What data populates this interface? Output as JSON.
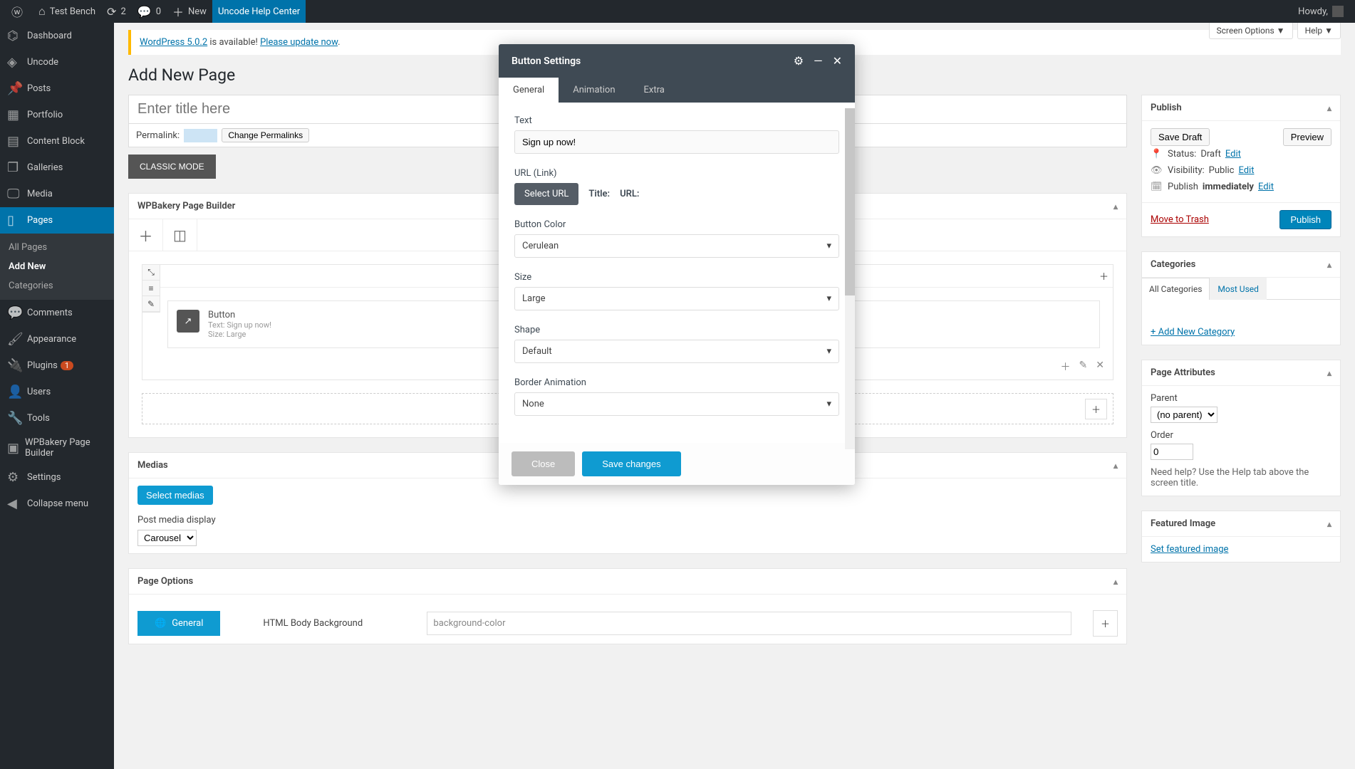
{
  "adminbar": {
    "site": "Test Bench",
    "updates": "2",
    "comments": "0",
    "new": "New",
    "help_center": "Uncode Help Center",
    "howdy": "Howdy,"
  },
  "sidebar": {
    "items": [
      {
        "label": "Dashboard",
        "icon": "⌬"
      },
      {
        "label": "Uncode",
        "icon": "◈"
      },
      {
        "label": "Posts",
        "icon": "📌"
      },
      {
        "label": "Portfolio",
        "icon": "▦"
      },
      {
        "label": "Content Block",
        "icon": "▤"
      },
      {
        "label": "Galleries",
        "icon": "❐"
      },
      {
        "label": "Media",
        "icon": "🖵"
      },
      {
        "label": "Pages",
        "icon": "▯",
        "current": true
      },
      {
        "label": "Comments",
        "icon": "💬"
      },
      {
        "label": "Appearance",
        "icon": "🖌"
      },
      {
        "label": "Plugins",
        "icon": "🔌",
        "badge": "1"
      },
      {
        "label": "Users",
        "icon": "👤"
      },
      {
        "label": "Tools",
        "icon": "🔧"
      },
      {
        "label": "WPBakery Page Builder",
        "icon": "▣"
      },
      {
        "label": "Settings",
        "icon": "⚙"
      },
      {
        "label": "Collapse menu",
        "icon": "◀"
      }
    ],
    "submenu": [
      {
        "label": "All Pages"
      },
      {
        "label": "Add New",
        "current": true
      },
      {
        "label": "Categories"
      }
    ]
  },
  "screen_tabs": {
    "options": "Screen Options ▼",
    "help": "Help ▼"
  },
  "notice": {
    "pre": "WordPress 5.0.2",
    "mid": " is available! ",
    "link": "Please update now"
  },
  "page": {
    "title": "Add New Page",
    "title_placeholder": "Enter title here",
    "permalink_label": "Permalink:",
    "change_permalinks": "Change Permalinks",
    "classic_mode": "CLASSIC MODE"
  },
  "wpb": {
    "title": "WPBakery Page Builder",
    "element": {
      "name": "Button",
      "meta1": "Text: Sign up now!",
      "meta2": "Size: Large"
    }
  },
  "medias": {
    "title": "Medias",
    "select": "Select medias",
    "display_label": "Post media display",
    "display_value": "Carousel"
  },
  "page_options": {
    "title": "Page Options",
    "tab": "General",
    "field": "HTML Body Background",
    "value": "background-color"
  },
  "publish": {
    "title": "Publish",
    "save_draft": "Save Draft",
    "preview": "Preview",
    "status_label": "Status:",
    "status_value": "Draft",
    "edit": "Edit",
    "vis_label": "Visibility:",
    "vis_value": "Public",
    "pub_label": "Publish",
    "pub_value": "immediately",
    "trash": "Move to Trash",
    "publish": "Publish"
  },
  "categories": {
    "title": "Categories",
    "all": "All Categories",
    "most": "Most Used",
    "add": "+ Add New Category"
  },
  "page_attrs": {
    "title": "Page Attributes",
    "parent": "Parent",
    "parent_value": "(no parent)",
    "order": "Order",
    "order_value": "0",
    "help": "Need help? Use the Help tab above the screen title."
  },
  "featured": {
    "title": "Featured Image",
    "link": "Set featured image"
  },
  "modal": {
    "title": "Button Settings",
    "tabs": {
      "general": "General",
      "animation": "Animation",
      "extra": "Extra"
    },
    "fields": {
      "text_label": "Text",
      "text_value": "Sign up now!",
      "url_label": "URL (Link)",
      "select_url": "Select URL",
      "title": "Title:",
      "url": "URL:",
      "color_label": "Button Color",
      "color_value": "Cerulean",
      "size_label": "Size",
      "size_value": "Large",
      "shape_label": "Shape",
      "shape_value": "Default",
      "border_label": "Border Animation",
      "border_value": "None"
    },
    "close": "Close",
    "save": "Save changes"
  }
}
